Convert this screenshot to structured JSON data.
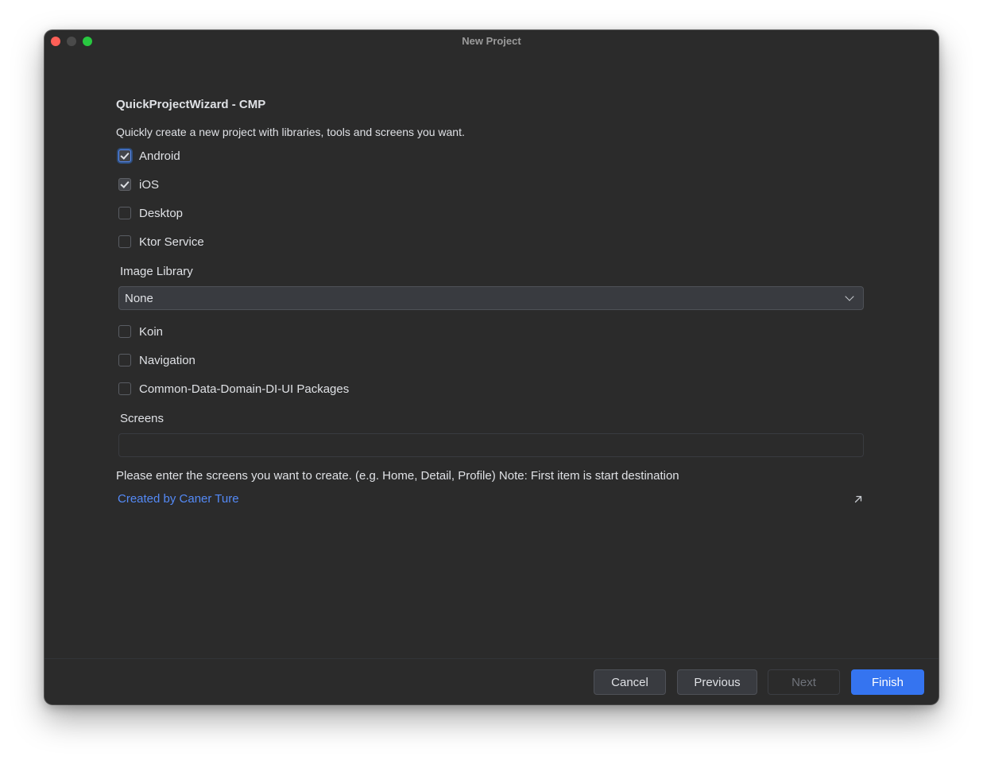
{
  "window": {
    "title": "New Project"
  },
  "wizard": {
    "heading": "QuickProjectWizard - CMP",
    "description": "Quickly create a new project with libraries, tools and screens you want."
  },
  "platforms": [
    {
      "label": "Android",
      "checked": true,
      "focused": true
    },
    {
      "label": "iOS",
      "checked": true,
      "focused": false
    },
    {
      "label": "Desktop",
      "checked": false,
      "focused": false
    },
    {
      "label": "Ktor Service",
      "checked": false,
      "focused": false
    }
  ],
  "image_library": {
    "label": "Image Library",
    "selected": "None"
  },
  "options": [
    {
      "label": "Koin",
      "checked": false
    },
    {
      "label": "Navigation",
      "checked": false
    },
    {
      "label": "Common-Data-Domain-DI-UI Packages",
      "checked": false
    }
  ],
  "screens": {
    "label": "Screens",
    "value": "",
    "hint": "Please enter the screens you want to create. (e.g. Home, Detail, Profile) Note: First item is start destination"
  },
  "credit": {
    "link_text": "Created by Caner Ture"
  },
  "footer": {
    "cancel_label": "Cancel",
    "previous_label": "Previous",
    "next_label": "Next",
    "finish_label": "Finish"
  },
  "colors": {
    "background": "#2b2b2b",
    "accent": "#3574f0",
    "link": "#548af7",
    "text": "#dfe1e5"
  }
}
